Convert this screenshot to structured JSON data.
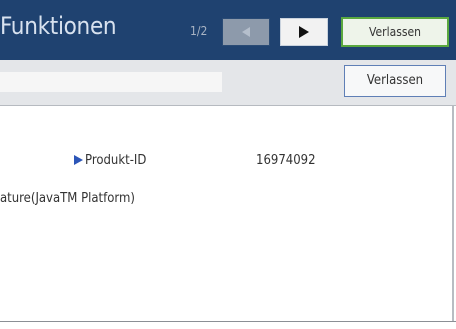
{
  "header": {
    "title": "Funktionen",
    "page_counter": "1/2",
    "exit_label": "Verlassen"
  },
  "subbar": {
    "exit_label": "Verlassen"
  },
  "content": {
    "product_id_label": "Produkt-ID",
    "product_id_value": "16974092",
    "feature_name": "ature(JavaTM Platform)"
  },
  "icons": {
    "prev": "triangle-left-icon",
    "next": "triangle-right-icon",
    "bullet": "triangle-right-bullet-icon"
  },
  "colors": {
    "header_bg": "#1f4270",
    "accent_green": "#5aa83f",
    "accent_blue": "#2c56b8"
  }
}
